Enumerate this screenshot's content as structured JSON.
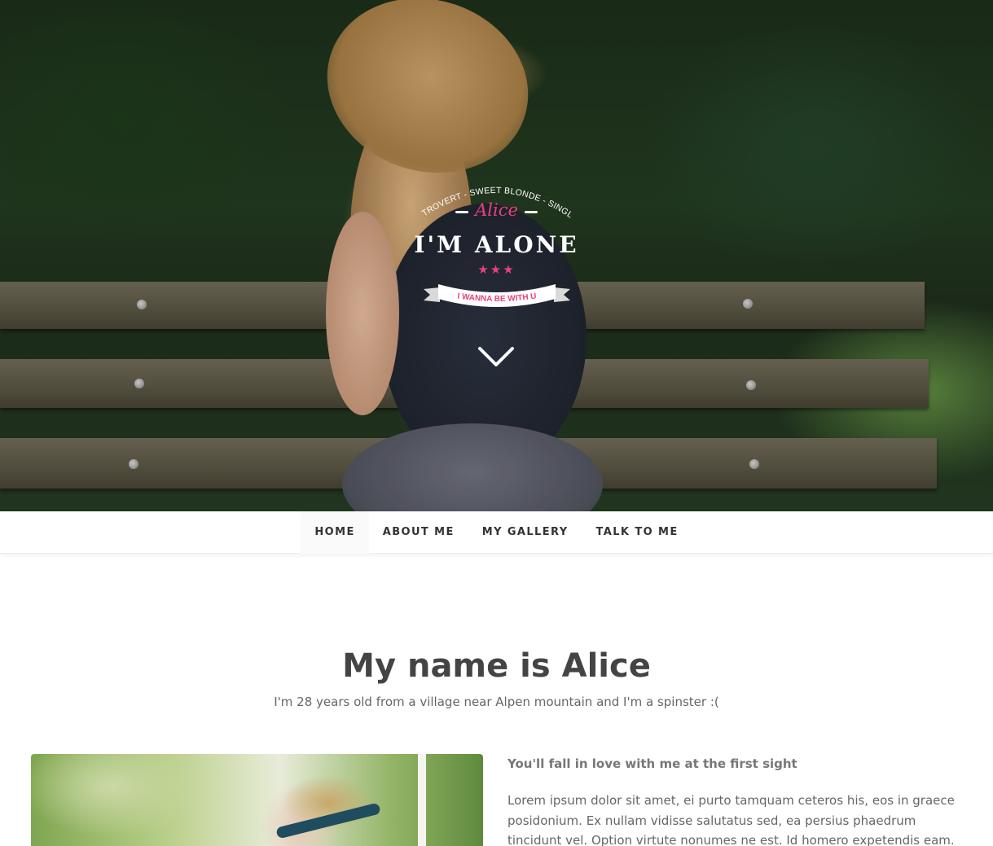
{
  "hero": {
    "badge_arc_text": "INTROVERT - SWEET BLONDE - SINGLE",
    "badge_name": "Alice",
    "badge_title": "I'M ALONE",
    "badge_stars": "★★★",
    "ribbon_text": "I WANNA BE WITH U",
    "accent_color": "#e6427e"
  },
  "nav": {
    "items": [
      {
        "label": "HOME"
      },
      {
        "label": "ABOUT ME"
      },
      {
        "label": "MY GALLERY"
      },
      {
        "label": "TALK TO ME"
      }
    ]
  },
  "intro": {
    "title": "My name is Alice",
    "subtitle": "I'm 28 years old from a village near Alpen mountain and I'm a spinster :("
  },
  "about": {
    "heading": "You'll fall in love with me at the first sight",
    "body": "Lorem ipsum dolor sit amet, ei purto tamquam ceteros his, eos in graece posidonium. Ex nullam vidisse salutatus sed, ea persius phaedrum tincidunt vel. Option virtute nonumes ne est. Id homero expetendis eam."
  }
}
